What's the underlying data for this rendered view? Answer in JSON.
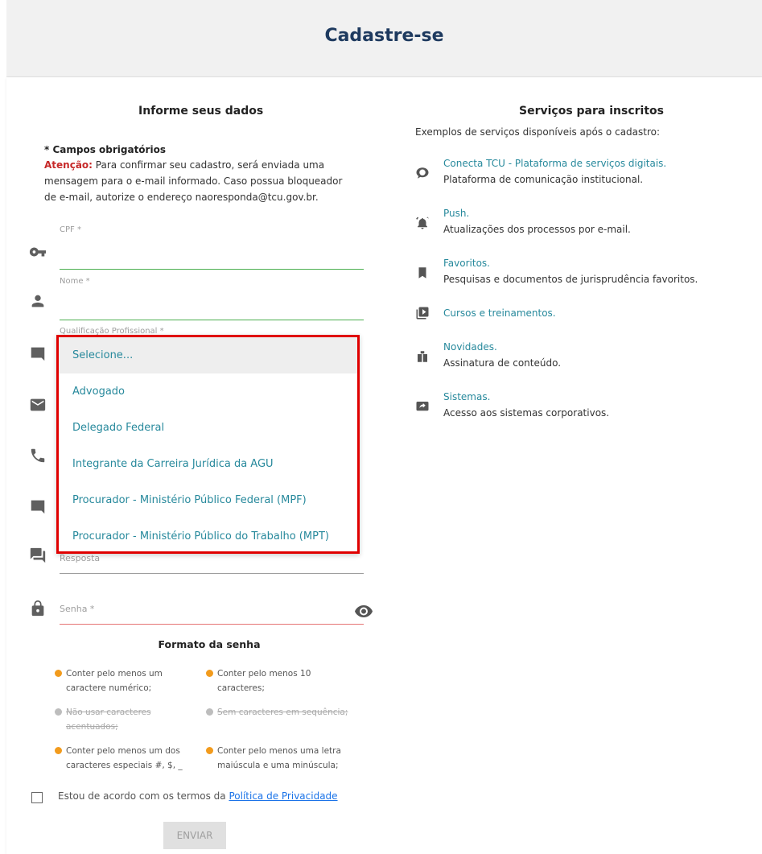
{
  "header": {
    "title": "Cadastre-se"
  },
  "form": {
    "heading": "Informe seus dados",
    "required_note": "* Campos obrigatórios",
    "attention_label": "Atenção:",
    "attention_text_1": "Para confirmar seu cadastro, será enviada uma",
    "attention_text_2": "mensagem para o e-mail informado. Caso possua bloqueador",
    "attention_text_3": "de e-mail, autorize o endereço naoresponda@tcu.gov.br.",
    "cpf_label": "CPF *",
    "nome_label": "Nome *",
    "qualificacao_label": "Qualificação Profissional *",
    "resposta_label": "Resposta",
    "senha_label": "Senha *"
  },
  "dropdown": {
    "options": [
      "Selecione...",
      "Advogado",
      "Delegado Federal",
      "Integrante da Carreira Jurídica da AGU",
      "Procurador - Ministério Público Federal (MPF)",
      "Procurador - Ministério Público do Trabalho (MPT)"
    ],
    "selected_index": 0,
    "highlight_color": "#e00000"
  },
  "password_rules": {
    "title": "Formato da senha",
    "rules": [
      {
        "text_1": "Conter pelo menos um",
        "text_2": "caractere numérico;",
        "status": "pending"
      },
      {
        "text_1": "Conter pelo menos 10",
        "text_2": "caracteres;",
        "status": "pending"
      },
      {
        "text_1": "Não usar caracteres",
        "text_2": "acentuados;",
        "status": "ok"
      },
      {
        "text_1": "Sem caracteres em sequência;",
        "text_2": "",
        "status": "ok"
      },
      {
        "text_1": "Conter pelo menos um dos",
        "text_2": "caracteres especiais #, $, _",
        "status": "pending"
      },
      {
        "text_1": "Conter pelo menos uma letra",
        "text_2": "maiúscula e uma minúscula;",
        "status": "pending"
      }
    ]
  },
  "agreement": {
    "text": "Estou de acordo com os termos da",
    "link": "Política de Privacidade"
  },
  "submit": {
    "label": "ENVIAR"
  },
  "services": {
    "heading": "Serviços para inscritos",
    "subtitle": "Exemplos de serviços disponíveis após o cadastro:",
    "items": [
      {
        "title": "Conecta TCU - Plataforma de serviços digitais.",
        "desc": "Plataforma de comunicação institucional.",
        "icon": "chat-bubble-icon"
      },
      {
        "title": "Push.",
        "desc": "Atualizações dos processos por e-mail.",
        "icon": "alarm-bell-icon"
      },
      {
        "title": "Favoritos.",
        "desc": "Pesquisas e documentos de jurisprudência favoritos.",
        "icon": "bookmark-icon"
      },
      {
        "title": "Cursos e treinamentos.",
        "desc": "",
        "icon": "video-library-icon"
      },
      {
        "title": "Novidades.",
        "desc": "Assinatura de conteúdo.",
        "icon": "mailbox-icon"
      },
      {
        "title": "Sistemas.",
        "desc": "Acesso aos sistemas corporativos.",
        "icon": "screen-share-icon"
      }
    ]
  }
}
